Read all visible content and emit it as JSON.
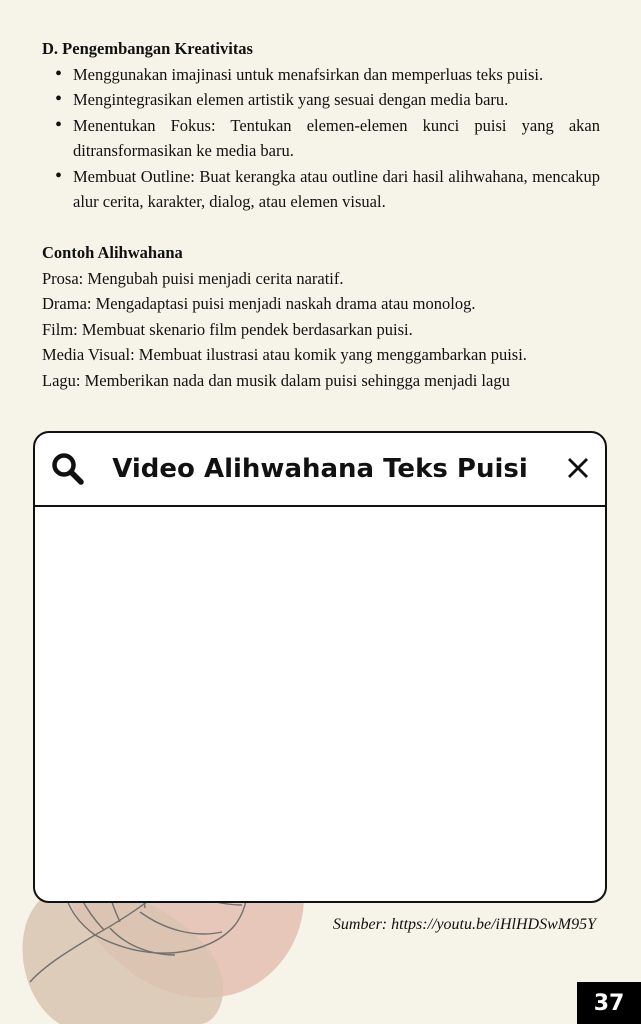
{
  "section_d": {
    "heading": "D. Pengembangan Kreativitas",
    "bullets": [
      "Menggunakan imajinasi untuk menafsirkan dan memperluas teks puisi.",
      "Mengintegrasikan elemen artistik yang sesuai dengan media baru.",
      "Menentukan Fokus: Tentukan elemen-elemen kunci puisi yang akan ditransformasikan ke media baru.",
      "Membuat Outline: Buat kerangka atau outline dari hasil alihwahana, mencakup alur cerita, karakter, dialog, atau elemen visual."
    ]
  },
  "contoh": {
    "heading": "Contoh Alihwahana",
    "lines": [
      "Prosa: Mengubah puisi menjadi cerita naratif.",
      "Drama: Mengadaptasi puisi menjadi naskah drama atau monolog.",
      "Film: Membuat skenario film pendek berdasarkan puisi.",
      "Media Visual: Membuat ilustrasi atau komik yang menggambarkan puisi.",
      "Lagu: Memberikan nada dan musik dalam puisi sehingga menjadi lagu"
    ]
  },
  "video_card": {
    "title": "Video Alihwahana Teks Puisi",
    "search_icon": "search-icon",
    "close_icon": "close-icon"
  },
  "source": "Sumber: https://youtu.be/iHlHDSwM95Y",
  "page_number": "37",
  "colors": {
    "background": "#f6f3e9",
    "deco_blob_pink": "#e7c7b9",
    "deco_blob_tan": "#d8c4b0",
    "page_number_bg": "#000000"
  }
}
